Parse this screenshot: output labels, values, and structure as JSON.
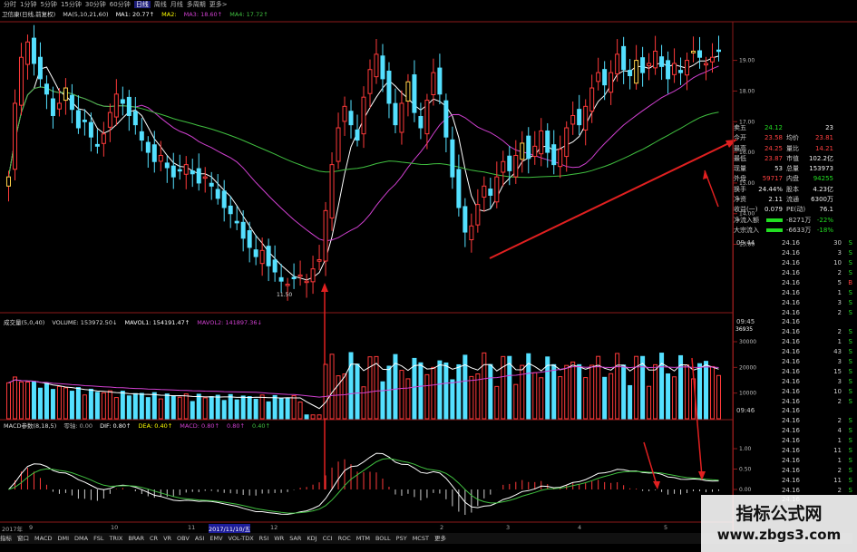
{
  "toolbar": {
    "items": [
      "分时",
      "1分钟",
      "5分钟",
      "15分钟",
      "30分钟",
      "60分钟",
      "日线",
      "周线",
      "月线",
      "多周期",
      "更多>"
    ],
    "active_index": 6
  },
  "main_legend": {
    "name": "卫信康(日线,前复权)",
    "ma_title": "MA(5,10,21,60)",
    "ma1": "MA1: 20.77↑",
    "ma2": "MA2: ",
    "ma3": "MA3: 18.60↑",
    "ma4": "MA4: 17.72↑"
  },
  "volume_legend": {
    "title": "成交量(5,0,40)",
    "volume": "VOLUME: 153972.50↓",
    "mavol1": "MAVOL1: 154191.47↑",
    "mavol2": "MAVOL2: 141897.36↓"
  },
  "macd_legend": {
    "title": "MACD参数(8,18,5)",
    "extra": "零轴: 0.00",
    "dif": "DIF: 0.80↑",
    "dea": "DEA: 0.40↑",
    "macd": "MACD: 0.80↑",
    "a": "0.80↑",
    "b": "0.40↑"
  },
  "annotations": {
    "low": "11.50",
    "volume_top": "36935"
  },
  "date_axis": [
    "2017年",
    "9",
    "10",
    "11",
    "2017/11/10/五",
    "12",
    "2",
    "3",
    "4",
    "5"
  ],
  "tabs": [
    "指标",
    "窗口",
    "MACD",
    "DMI",
    "DMA",
    "FSL",
    "TRIX",
    "BRAR",
    "CR",
    "VR",
    "OBV",
    "ASI",
    "EMV",
    "VOL-TDX",
    "RSI",
    "WR",
    "SAR",
    "KDJ",
    "CCI",
    "ROC",
    "MTM",
    "BOLL",
    "PSY",
    "MCST",
    "更多"
  ],
  "quote": [
    {
      "l1": "卖五",
      "v1": "24.12",
      "c1": "green",
      "l2": "",
      "v2": "23",
      "c2": "white"
    },
    {
      "l1": "今开",
      "v1": "23.58",
      "c1": "red",
      "l2": "均价",
      "v2": "23.81",
      "c2": "red"
    },
    {
      "l1": "最高",
      "v1": "24.25",
      "c1": "red",
      "l2": "量比",
      "v2": "14.21",
      "c2": "red"
    },
    {
      "l1": "最低",
      "v1": "23.87",
      "c1": "red",
      "l2": "市值",
      "v2": "102.2亿",
      "c2": "white"
    },
    {
      "l1": "现量",
      "v1": "53",
      "c1": "white",
      "l2": "总量",
      "v2": "153973",
      "c2": "white"
    },
    {
      "l1": "外盘",
      "v1": "59717",
      "c1": "red",
      "l2": "内盘",
      "v2": "94255",
      "c2": "green"
    },
    {
      "l1": "换手",
      "v1": "24.44%",
      "c1": "white",
      "l2": "股本",
      "v2": "4.23亿",
      "c2": "white"
    },
    {
      "l1": "净资",
      "v1": "2.11",
      "c1": "white",
      "l2": "流通",
      "v2": "6300万",
      "c2": "white"
    },
    {
      "l1": "收益(一)",
      "v1": "0.079",
      "c1": "white",
      "l2": "PE(动)",
      "v2": "76.1",
      "c2": "white"
    },
    {
      "l1": "净流入额",
      "v1": "",
      "c1": "green",
      "l2": "-8271万",
      "v2": "-22%",
      "c2": "green"
    },
    {
      "l1": "大宗流入",
      "v1": "",
      "c1": "green",
      "l2": "-6633万",
      "v2": "-18%",
      "c2": "green"
    }
  ],
  "ticks": [
    {
      "t": "09:44",
      "p": "24.16",
      "q": "30",
      "s": "S"
    },
    {
      "t": "",
      "p": "24.16",
      "q": "3",
      "s": "S"
    },
    {
      "t": "",
      "p": "24.16",
      "q": "10",
      "s": "S"
    },
    {
      "t": "",
      "p": "24.16",
      "q": "2",
      "s": "S"
    },
    {
      "t": "",
      "p": "24.16",
      "q": "5",
      "s": "B"
    },
    {
      "t": "",
      "p": "24.16",
      "q": "1",
      "s": "S"
    },
    {
      "t": "",
      "p": "24.16",
      "q": "3",
      "s": "S"
    },
    {
      "t": "",
      "p": "24.16",
      "q": "2",
      "s": "S"
    },
    {
      "t": "09:45",
      "p": "24.16",
      "q": "",
      "s": ""
    },
    {
      "t": "",
      "p": "24.16",
      "q": "2",
      "s": "S"
    },
    {
      "t": "",
      "p": "24.16",
      "q": "1",
      "s": "S"
    },
    {
      "t": "",
      "p": "24.16",
      "q": "43",
      "s": "S"
    },
    {
      "t": "",
      "p": "24.16",
      "q": "3",
      "s": "S"
    },
    {
      "t": "",
      "p": "24.16",
      "q": "15",
      "s": "S"
    },
    {
      "t": "",
      "p": "24.16",
      "q": "3",
      "s": "S"
    },
    {
      "t": "",
      "p": "24.16",
      "q": "10",
      "s": "S"
    },
    {
      "t": "",
      "p": "24.16",
      "q": "2",
      "s": "S"
    },
    {
      "t": "09:46",
      "p": "24.16",
      "q": "",
      "s": ""
    },
    {
      "t": "",
      "p": "24.16",
      "q": "2",
      "s": "S"
    },
    {
      "t": "",
      "p": "24.16",
      "q": "4",
      "s": "S"
    },
    {
      "t": "",
      "p": "24.16",
      "q": "1",
      "s": "S"
    },
    {
      "t": "",
      "p": "24.16",
      "q": "11",
      "s": "S"
    },
    {
      "t": "",
      "p": "24.16",
      "q": "1",
      "s": "S"
    },
    {
      "t": "",
      "p": "24.16",
      "q": "2",
      "s": "S"
    },
    {
      "t": "",
      "p": "24.16",
      "q": "11",
      "s": "S"
    },
    {
      "t": "",
      "p": "24.16",
      "q": "2",
      "s": "S"
    },
    {
      "t": "",
      "p": "24.16",
      "q": "",
      "s": ""
    }
  ],
  "chart_data": {
    "type": "candlestick",
    "price_axis_ticks": [
      "19.00",
      "18.00",
      "17.00",
      "16.00",
      "15.00",
      "14.00",
      "13.00"
    ],
    "volume_axis_ticks": [
      "30000",
      "20000",
      "10000"
    ],
    "macd_axis_ticks": [
      "1.00",
      "0.50",
      "0.00"
    ],
    "price_range": [
      10.8,
      20.2
    ],
    "closes": [
      15.2,
      17.6,
      19.1,
      19.6,
      18.9,
      18.4,
      17.9,
      17.2,
      17.6,
      18.1,
      17.4,
      16.8,
      17.0,
      16.5,
      16.2,
      16.6,
      17.3,
      17.9,
      17.6,
      17.2,
      16.9,
      16.4,
      16.0,
      15.7,
      15.9,
      15.5,
      15.2,
      15.4,
      15.6,
      15.3,
      15.0,
      15.2,
      14.9,
      14.5,
      14.2,
      14.0,
      13.7,
      13.2,
      12.9,
      12.6,
      12.8,
      12.3,
      12.1,
      11.8,
      11.7,
      11.9,
      12.0,
      11.8,
      12.2,
      12.5,
      14.1,
      15.6,
      16.8,
      17.5,
      16.9,
      16.4,
      17.8,
      18.7,
      19.2,
      18.4,
      17.6,
      16.9,
      17.6,
      18.3,
      17.3,
      16.8,
      17.7,
      18.6,
      17.9,
      16.5,
      15.2,
      14.2,
      13.4,
      13.6,
      14.3,
      14.9,
      14.6,
      15.2,
      15.7,
      15.4,
      15.9,
      16.3,
      15.8,
      16.2,
      16.7,
      16.0,
      15.6,
      16.1,
      16.8,
      17.2,
      16.9,
      17.5,
      18.1,
      18.6,
      18.2,
      18.6,
      19.2,
      18.7,
      18.5,
      19.0,
      18.6,
      18.9,
      19.3,
      18.8,
      18.4,
      18.9,
      18.6,
      19.0,
      19.3,
      19.1,
      18.9,
      19.1,
      19.3
    ]
  }
}
